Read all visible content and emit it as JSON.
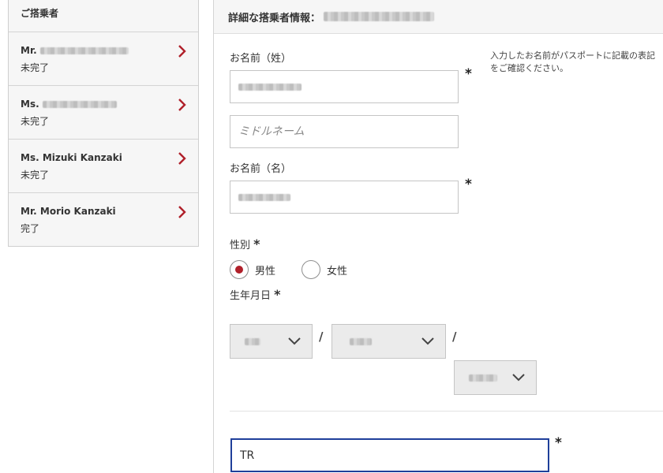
{
  "sidebar": {
    "title": "ご搭乗者",
    "passengers": [
      {
        "prefix": "Mr.",
        "name": "",
        "status": "未完了"
      },
      {
        "prefix": "Ms.",
        "name": "",
        "status": "未完了"
      },
      {
        "prefix": "Ms.",
        "name": "Mizuki Kanzaki",
        "status": "未完了"
      },
      {
        "prefix": "Mr.",
        "name": "Morio Kanzaki",
        "status": "完了"
      }
    ]
  },
  "form": {
    "heading": "詳細な搭乗者情報：",
    "last_name_label": "お名前（姓）",
    "middle_name_placeholder": "ミドルネーム",
    "first_name_label": "お名前（名）",
    "hint_text_line1": "入力したお名前がパスポートに記載の表記",
    "hint_text_line2": "をご確認ください。",
    "required_mark": "*",
    "gender_label": "性別",
    "gender_options": [
      "男性",
      "女性"
    ],
    "gender_selected": "男性",
    "birthdate_label": "生年月日",
    "date_separator": "/",
    "focused_field_value": "TR"
  },
  "colors": {
    "accent_red": "#b0202a",
    "focus_blue": "#1f3f9a"
  },
  "icons": {
    "chevron_right": "chevron-right-icon",
    "chevron_down": "chevron-down-icon"
  }
}
